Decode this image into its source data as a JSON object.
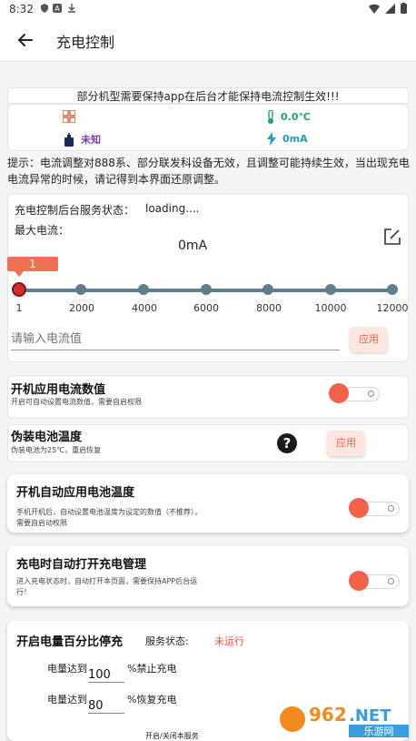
{
  "status_bar": {
    "time": "8:32"
  },
  "appbar": {
    "title": "充电控制"
  },
  "notice": "部分机型需要保持app在后台才能保持电流控制生效!!!",
  "info": {
    "temperature": "0.0℃",
    "battery_status": "未知",
    "current": "0mA"
  },
  "hint": "提示：电流调整对888系、部分联发科设备无效，且调整可能持续生效，当出现充电电流异常的时候，请记得到本界面还原调整。",
  "control": {
    "service_label": "充电控制后台服务状态：",
    "service_value": "loading....",
    "max_current_label": "最大电流：",
    "current_value": "0mA",
    "slider_bubble": "1",
    "slider_value": 1,
    "slider_min": 1,
    "slider_max": 12000,
    "ticks": [
      "1",
      "2000",
      "4000",
      "6000",
      "8000",
      "10000",
      "12000"
    ],
    "input_placeholder": "请输入电流值",
    "apply_label": "应用"
  },
  "boot_current": {
    "title": "开机应用电流数值",
    "subtitle": "开启可自动设置电流数值，需要自启权限"
  },
  "fake_temp": {
    "title": "伪装电池温度",
    "subtitle": "伪装电池为25℃，重启恢复",
    "apply_label": "应用"
  },
  "boot_temp": {
    "title": "开机自动应用电池温度",
    "subtitle": "手机开机后，自动设置电池温度为设定的数值（不推荐），需要自启动权限"
  },
  "auto_open": {
    "title": "充电时自动打开充电管理",
    "subtitle": "进入充电状态时，自动打开本页面，需要保持APP后台运行！"
  },
  "percent_stop": {
    "title": "开启电量百分比停充",
    "service_label": "服务状态:",
    "service_value": "未运行",
    "reach_label": "电量达到",
    "stop_value": "100",
    "stop_label": "%禁止充电",
    "resume_label": "电量达到",
    "resume_value": "80",
    "resume_suffix": "%恢复充电",
    "toggle_label": "开启/关闭本服务"
  },
  "watermark": {
    "text": "962.NET",
    "sub": "乐游网"
  },
  "colors": {
    "accent": "#f0634a",
    "slider": "#5f7f8d",
    "green": "#1fa37a",
    "purple": "#7b3fa8",
    "teal": "#1f9ac0"
  }
}
